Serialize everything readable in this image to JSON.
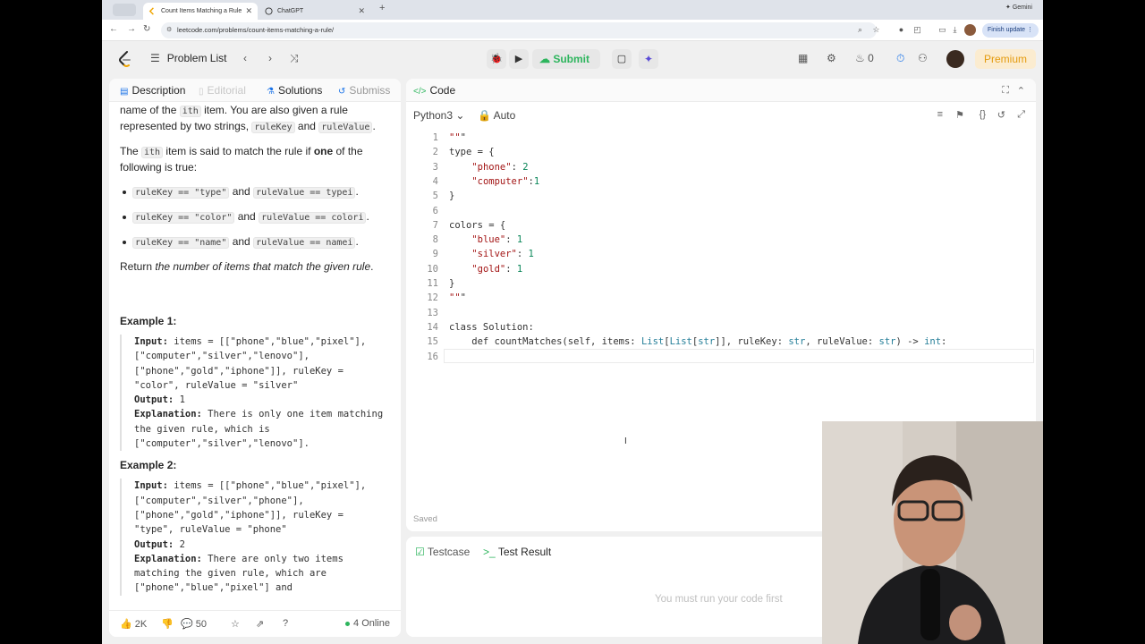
{
  "browser": {
    "tabs": [
      {
        "title": "Count Items Matching a Rule"
      },
      {
        "title": "ChatGPT"
      }
    ],
    "url": "leetcode.com/problems/count-items-matching-a-rule/",
    "gemini_label": "Gemini",
    "finish_update_label": "Finish update"
  },
  "header": {
    "problem_list_label": "Problem List",
    "submit_label": "Submit",
    "streak_count": "0",
    "premium_label": "Premium"
  },
  "description_panel": {
    "tabs": [
      "Description",
      "Editorial",
      "Solutions",
      "Submiss"
    ],
    "intro_1a": "name of the ",
    "intro_1b": "ith",
    "intro_1c": " item. You are also given a rule represented by two strings, ",
    "rulekey": "ruleKey",
    "and": " and ",
    "rulevalue": "ruleValue",
    "period": ".",
    "match_a": "The ",
    "match_b": "ith",
    "match_c": " item is said to match the rule if ",
    "match_one": "one",
    "match_d": " of the following is true:",
    "bullets": [
      {
        "left": "ruleKey == \"type\"",
        "right": "ruleValue == typei"
      },
      {
        "left": "ruleKey == \"color\"",
        "right": "ruleValue == colori"
      },
      {
        "left": "ruleKey == \"name\"",
        "right": "ruleValue == namei"
      }
    ],
    "return_a": "Return ",
    "return_b": "the number of items that match the given rule",
    "return_c": ".",
    "example1_title": "Example 1:",
    "example1_input_label": "Input:",
    "example1_input": " items = [[\"phone\",\"blue\",\"pixel\"],[\"computer\",\"silver\",\"lenovo\"],[\"phone\",\"gold\",\"iphone\"]], ruleKey = \"color\", ruleValue = \"silver\"",
    "example1_output_label": "Output:",
    "example1_output": " 1",
    "example1_expl_label": "Explanation:",
    "example1_expl": " There is only one item matching the given rule, which is [\"computer\",\"silver\",\"lenovo\"].",
    "example2_title": "Example 2:",
    "example2_input_label": "Input:",
    "example2_input": " items = [[\"phone\",\"blue\",\"pixel\"],[\"computer\",\"silver\",\"phone\"],[\"phone\",\"gold\",\"iphone\"]], ruleKey = \"type\", ruleValue = \"phone\"",
    "example2_output_label": "Output:",
    "example2_output": " 2",
    "example2_expl_label": "Explanation:",
    "example2_expl": " There are only two items matching the given rule, which are [\"phone\",\"blue\",\"pixel\"] and",
    "likes": "2K",
    "comments": "50",
    "online": "4 Online"
  },
  "editor": {
    "title": "Code",
    "language": "Python3",
    "mode": "Auto",
    "lines": [
      "\"\"\"",
      "type = {",
      "    \"phone\": 2",
      "    \"computer\":1",
      "}",
      "",
      "colors = {",
      "    \"blue\": 1",
      "    \"silver\": 1",
      "    \"gold\": 1",
      "}",
      "\"\"\"",
      "",
      "class Solution:",
      "    def countMatches(self, items: List[List[str]], ruleKey: str, ruleValue: str) -> int:",
      ""
    ],
    "status": "Saved"
  },
  "result_panel": {
    "tabs": [
      "Testcase",
      "Test Result"
    ],
    "message": "You must run your code first"
  },
  "colors": {
    "accent_green": "#2db55d",
    "premium_orange": "#e49b0f",
    "ai_purple": "#5a4bd6"
  }
}
